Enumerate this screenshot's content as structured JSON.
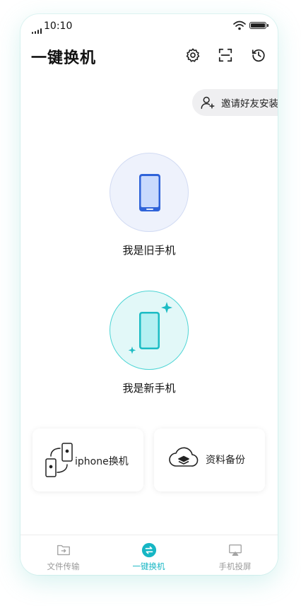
{
  "status_bar": {
    "time": "10:10"
  },
  "header": {
    "title": "一键换机",
    "icons": [
      "gear-icon",
      "scan-icon",
      "history-icon"
    ]
  },
  "invite": {
    "label": "邀请好友安装",
    "icon": "add-user-icon"
  },
  "old_phone": {
    "label": "我是旧手机",
    "icon": "phone-icon"
  },
  "new_phone": {
    "label": "我是新手机",
    "icon": "sparkle-phone-icon"
  },
  "cards": [
    {
      "label": "iphone换机",
      "icon": "phone-transfer-icon"
    },
    {
      "label": "资料备份",
      "icon": "cloud-backup-icon"
    }
  ],
  "tabs": [
    {
      "label": "文件传输",
      "icon": "folder-transfer-icon",
      "active": false
    },
    {
      "label": "一键换机",
      "icon": "swap-icon",
      "active": true
    },
    {
      "label": "手机投屏",
      "icon": "screen-cast-icon",
      "active": false
    }
  ],
  "colors": {
    "accent": "#16b6c4",
    "old_phone_blue": "#2f63d9",
    "new_phone_teal": "#1cbcc4"
  }
}
